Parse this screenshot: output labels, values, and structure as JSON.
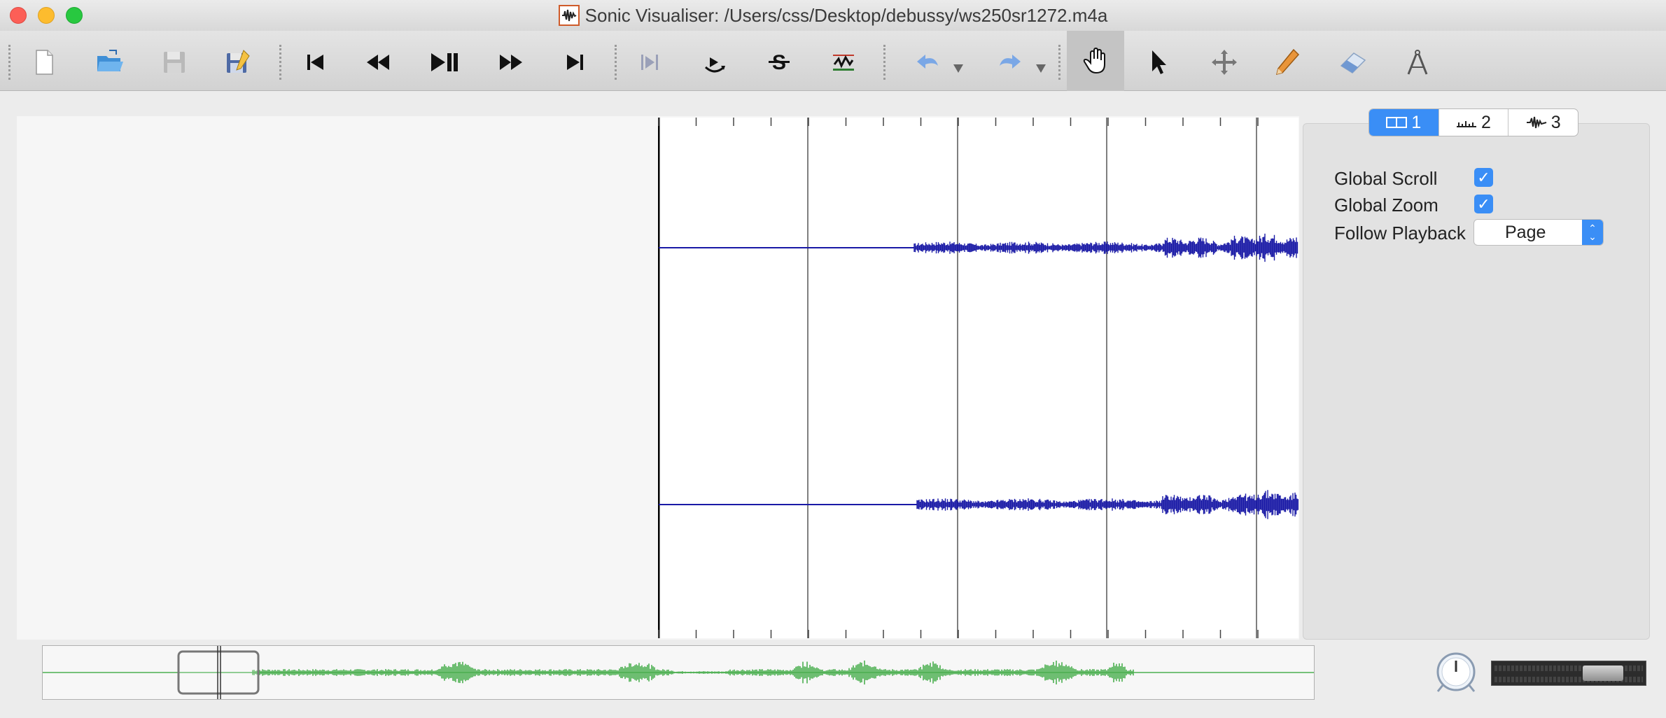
{
  "window": {
    "title": "Sonic Visualiser: /Users/css/Desktop/debussy/ws250sr1272.m4a"
  },
  "toolbar": {
    "items": [
      {
        "name": "new-session-icon"
      },
      {
        "name": "open-icon"
      },
      {
        "name": "save-icon"
      },
      {
        "name": "save-as-icon"
      },
      {
        "name": "rewind-start-icon"
      },
      {
        "name": "rewind-icon"
      },
      {
        "name": "play-pause-icon"
      },
      {
        "name": "fast-forward-icon"
      },
      {
        "name": "fast-forward-end-icon"
      },
      {
        "name": "play-selection-icon"
      },
      {
        "name": "loop-icon"
      },
      {
        "name": "solo-icon"
      },
      {
        "name": "align-icon"
      },
      {
        "name": "undo-icon"
      },
      {
        "name": "redo-icon"
      },
      {
        "name": "navigate-hand-icon"
      },
      {
        "name": "select-arrow-icon"
      },
      {
        "name": "move-icon"
      },
      {
        "name": "draw-pencil-icon"
      },
      {
        "name": "erase-icon"
      },
      {
        "name": "measure-icon"
      }
    ],
    "active_tool": "navigate-hand-icon"
  },
  "property_panel": {
    "tabs": [
      {
        "label": "1",
        "icon": "pane-icon",
        "selected": true
      },
      {
        "label": "2",
        "icon": "ruler-icon",
        "selected": false
      },
      {
        "label": "3",
        "icon": "waveform-icon",
        "selected": false
      }
    ],
    "global_scroll_label": "Global Scroll",
    "global_scroll_checked": true,
    "global_zoom_label": "Global Zoom",
    "global_zoom_checked": true,
    "follow_playback_label": "Follow Playback",
    "follow_playback_value": "Page"
  },
  "colors": {
    "waveform": "#1a1aa6",
    "overview_waveform": "#4caf50",
    "accent": "#3a8ef6"
  }
}
